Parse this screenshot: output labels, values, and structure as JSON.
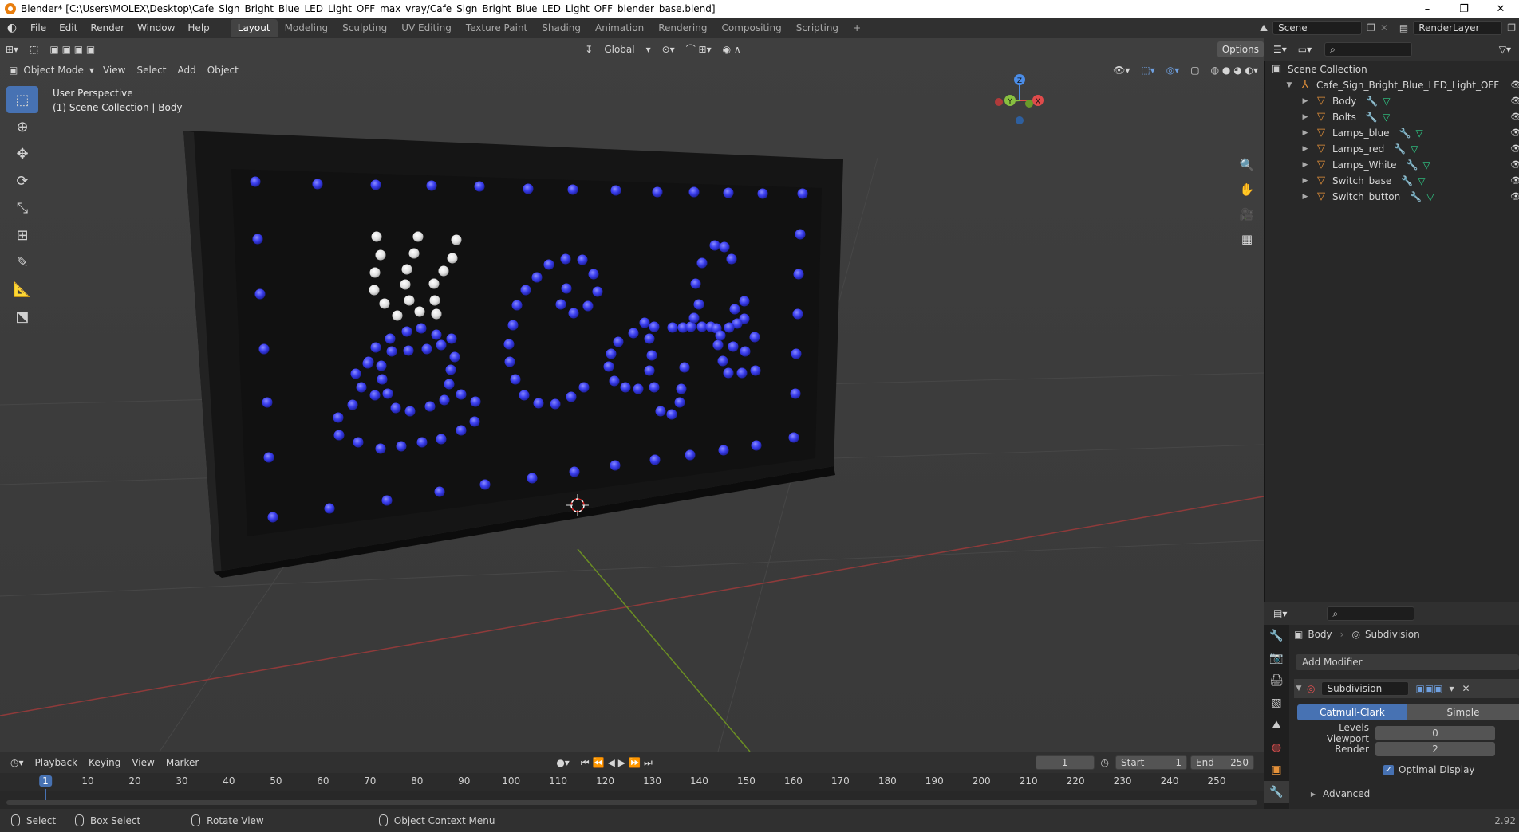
{
  "window": {
    "title": "Blender* [C:\\Users\\MOLEX\\Desktop\\Cafe_Sign_Bright_Blue_LED_Light_OFF_max_vray/Cafe_Sign_Bright_Blue_LED_Light_OFF_blender_base.blend]",
    "minimize": "–",
    "restore": "❐",
    "close": "✕"
  },
  "menubar": {
    "items": [
      "File",
      "Edit",
      "Render",
      "Window",
      "Help"
    ],
    "workspaces": [
      "Layout",
      "Modeling",
      "Sculpting",
      "UV Editing",
      "Texture Paint",
      "Shading",
      "Animation",
      "Rendering",
      "Compositing",
      "Scripting"
    ],
    "active_workspace": "Layout",
    "add_workspace": "+",
    "scene": "Scene",
    "render_layer": "RenderLayer"
  },
  "viewport_header": {
    "transform_orientation": "Global",
    "options": "Options",
    "mode": "Object Mode",
    "menus": [
      "View",
      "Select",
      "Add",
      "Object"
    ]
  },
  "viewport": {
    "perspective": "User Perspective",
    "collection_info": "(1) Scene Collection | Body",
    "gizmo": {
      "z": "Z",
      "y": "Y",
      "x": "X"
    },
    "sign_text": "Café"
  },
  "outliner": {
    "root": "Scene Collection",
    "collection": "Cafe_Sign_Bright_Blue_LED_Light_OFF",
    "objects": [
      {
        "name": "Body"
      },
      {
        "name": "Bolts"
      },
      {
        "name": "Lamps_blue"
      },
      {
        "name": "Lamps_red"
      },
      {
        "name": "Lamps_White"
      },
      {
        "name": "Switch_base"
      },
      {
        "name": "Switch_button"
      }
    ]
  },
  "properties": {
    "object": "Body",
    "modifier_tab": "Subdivision",
    "add_modifier": "Add Modifier",
    "modifier_name": "Subdivision",
    "type_options": [
      "Catmull-Clark",
      "Simple"
    ],
    "active_type": "Catmull-Clark",
    "levels_viewport_label": "Levels Viewport",
    "levels_viewport": "0",
    "render_label": "Render",
    "render_value": "2",
    "optimal_display": "Optimal Display",
    "optimal_display_checked": true,
    "advanced": "Advanced",
    "truncated_value": "2.92"
  },
  "timeline": {
    "menus": [
      "Playback",
      "Keying",
      "View",
      "Marker"
    ],
    "current_frame": "1",
    "start_label": "Start",
    "start": "1",
    "end_label": "End",
    "end": "250",
    "ruler": [
      "1",
      "10",
      "20",
      "30",
      "40",
      "50",
      "60",
      "70",
      "80",
      "90",
      "100",
      "110",
      "120",
      "130",
      "140",
      "150",
      "160",
      "170",
      "180",
      "190",
      "200",
      "210",
      "220",
      "230",
      "240",
      "250"
    ]
  },
  "statusbar": {
    "select": "Select",
    "box_select": "Box Select",
    "rotate_view": "Rotate View",
    "context_menu": "Object Context Menu"
  },
  "colors": {
    "accent": "#4772b3",
    "led_blue": "#3a3ff5",
    "led_white": "#e8e8e8",
    "object_orange": "#e6923a"
  }
}
